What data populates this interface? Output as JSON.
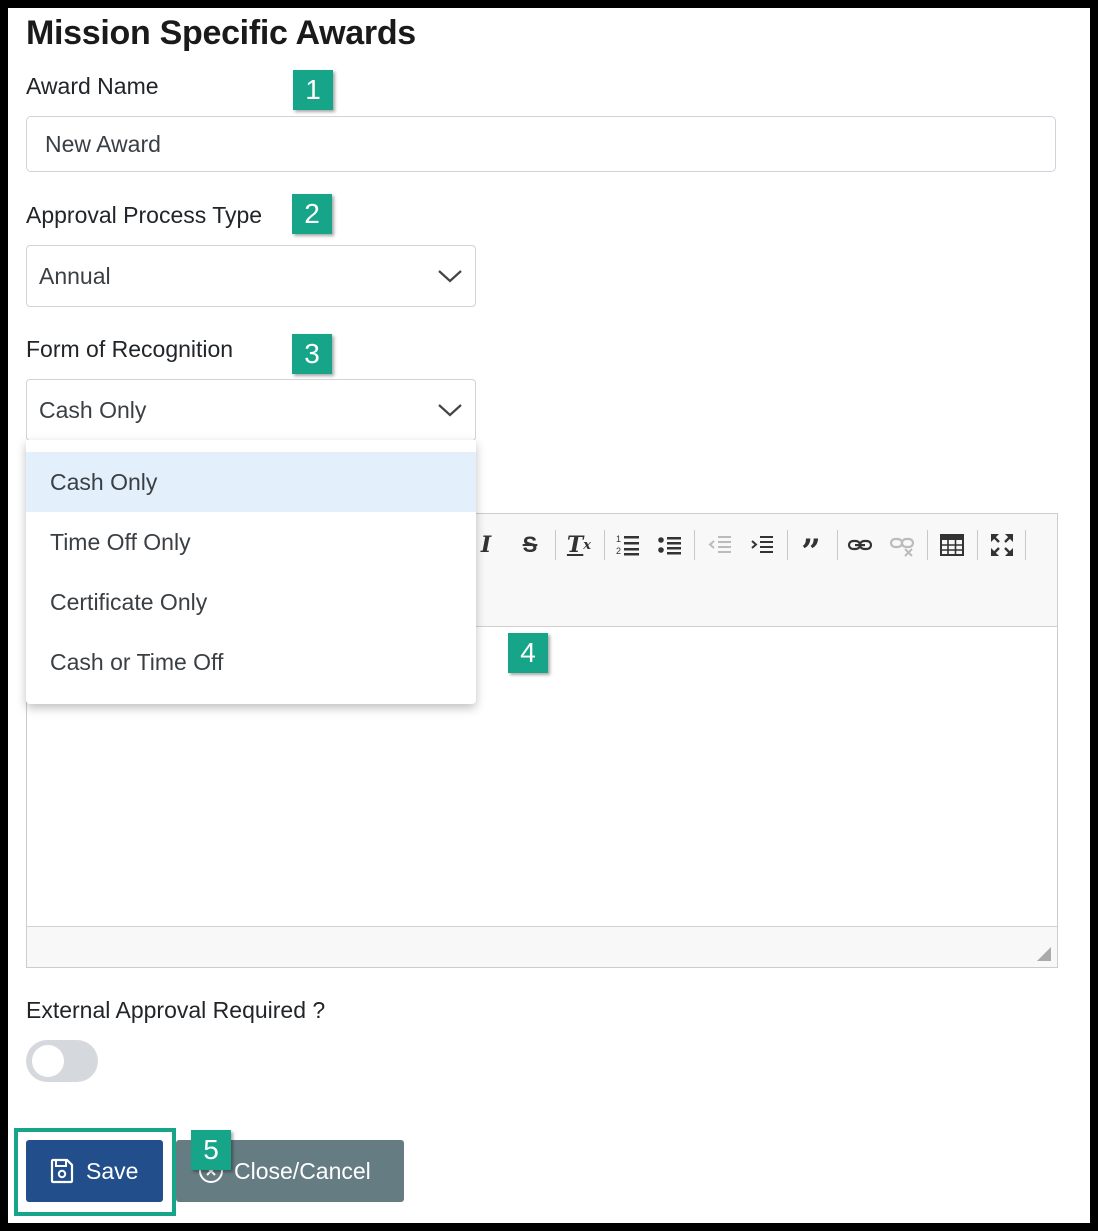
{
  "page": {
    "title": "Mission Specific Awards"
  },
  "award_name": {
    "label": "Award Name",
    "value": "New Award"
  },
  "approval_type": {
    "label": "Approval Process Type",
    "value": "Annual"
  },
  "recognition": {
    "label": "Form of Recognition",
    "value": "Cash Only",
    "options": [
      "Cash Only",
      "Time Off Only",
      "Certificate Only",
      "Cash or Time Off"
    ]
  },
  "toolbar": {
    "icons": [
      "italic-icon",
      "strikethrough-icon",
      "remove-format-icon",
      "numbered-list-icon",
      "bulleted-list-icon",
      "decrease-indent-icon",
      "increase-indent-icon",
      "blockquote-icon",
      "link-icon",
      "unlink-icon",
      "table-icon",
      "maximize-icon"
    ]
  },
  "external_approval": {
    "label": "External Approval Required ?",
    "enabled": false
  },
  "buttons": {
    "save": "Save",
    "cancel": "Close/Cancel"
  },
  "callouts": [
    "1",
    "2",
    "3",
    "4",
    "5"
  ],
  "colors": {
    "callout": "#17a589",
    "save": "#224e8c",
    "cancel": "#667c83",
    "selected_option": "#e3f0fb"
  }
}
